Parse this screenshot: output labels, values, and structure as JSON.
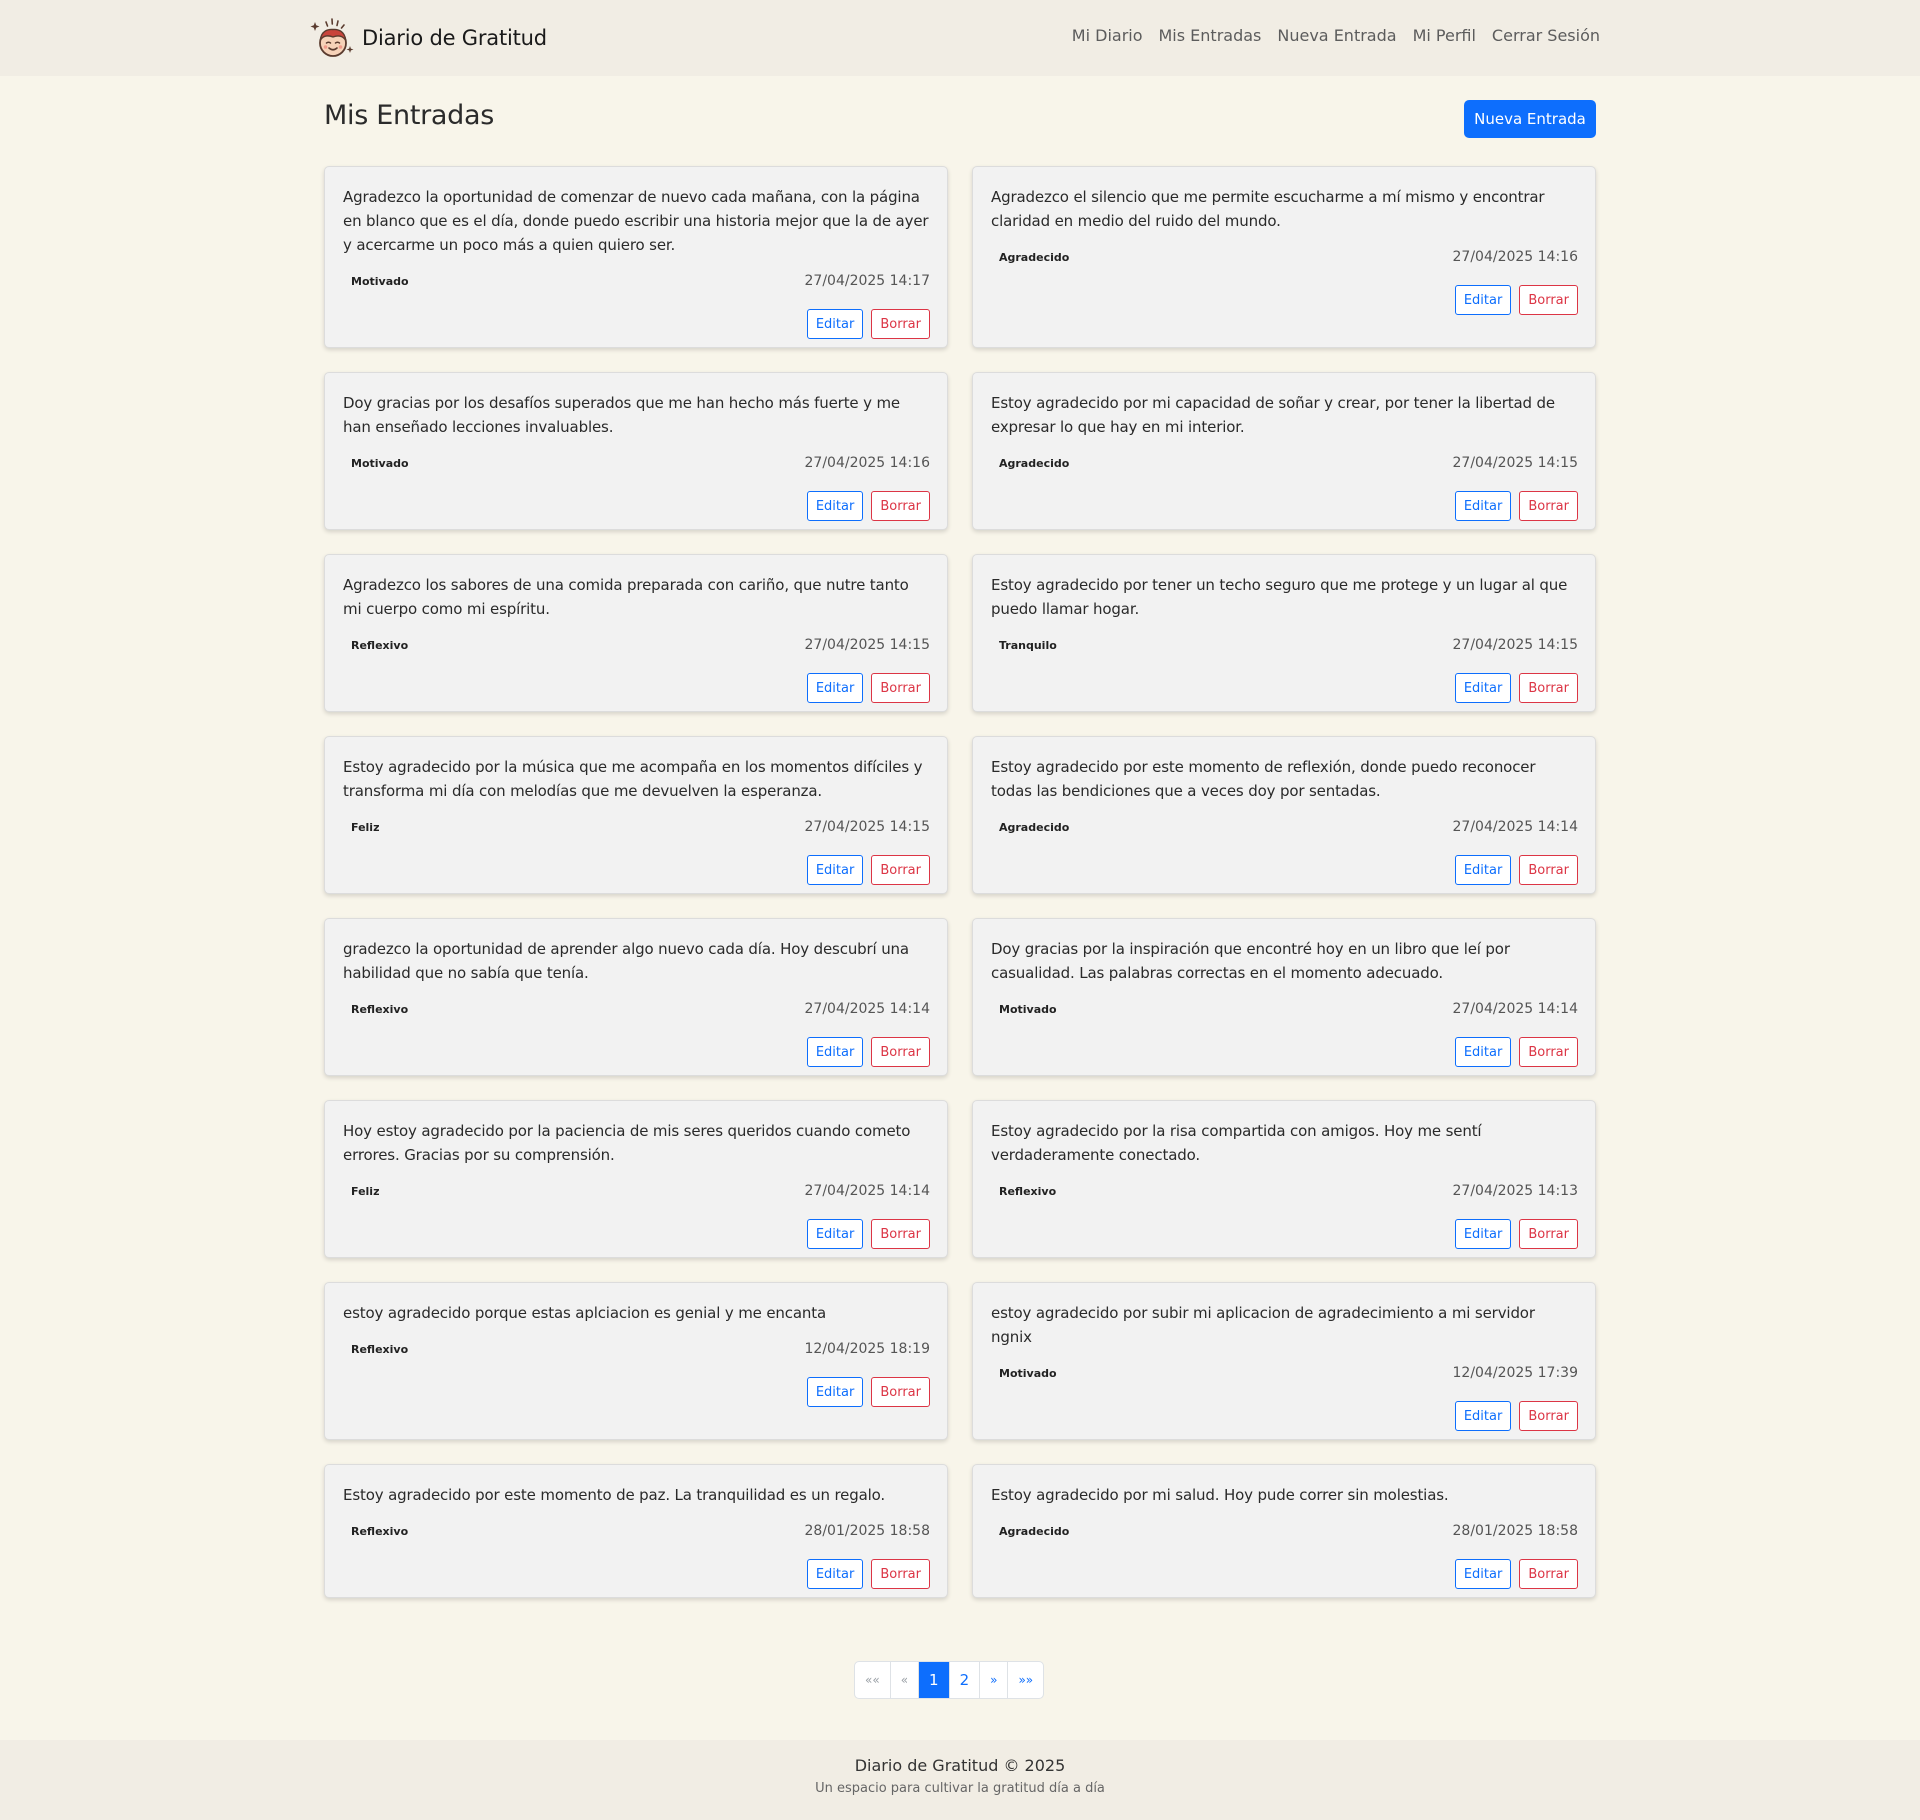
{
  "nav": {
    "brand": "Diario de Gratitud",
    "links": [
      "Mi Diario",
      "Mis Entradas",
      "Nueva Entrada",
      "Mi Perfil",
      "Cerrar Sesión"
    ]
  },
  "page": {
    "title": "Mis Entradas",
    "new_button": "Nueva Entrada"
  },
  "labels": {
    "edit": "Editar",
    "delete": "Borrar"
  },
  "entries": [
    {
      "text": "Agradezco la oportunidad de comenzar de nuevo cada mañana, con la página en blanco que es el día, donde puedo escribir una historia mejor que la de ayer y acercarme un poco más a quien quiero ser.",
      "mood": "Motivado",
      "date": "27/04/2025 14:17"
    },
    {
      "text": "Agradezco el silencio que me permite escucharme a mí mismo y encontrar claridad en medio del ruido del mundo.",
      "mood": "Agradecido",
      "date": "27/04/2025 14:16"
    },
    {
      "text": "Doy gracias por los desafíos superados que me han hecho más fuerte y me han enseñado lecciones invaluables.",
      "mood": "Motivado",
      "date": "27/04/2025 14:16"
    },
    {
      "text": "Estoy agradecido por mi capacidad de soñar y crear, por tener la libertad de expresar lo que hay en mi interior.",
      "mood": "Agradecido",
      "date": "27/04/2025 14:15"
    },
    {
      "text": "Agradezco los sabores de una comida preparada con cariño, que nutre tanto mi cuerpo como mi espíritu.",
      "mood": "Reflexivo",
      "date": "27/04/2025 14:15"
    },
    {
      "text": "Estoy agradecido por tener un techo seguro que me protege y un lugar al que puedo llamar hogar.",
      "mood": "Tranquilo",
      "date": "27/04/2025 14:15"
    },
    {
      "text": "Estoy agradecido por la música que me acompaña en los momentos difíciles y transforma mi día con melodías que me devuelven la esperanza.",
      "mood": "Feliz",
      "date": "27/04/2025 14:15"
    },
    {
      "text": "Estoy agradecido por este momento de reflexión, donde puedo reconocer todas las bendiciones que a veces doy por sentadas.",
      "mood": "Agradecido",
      "date": "27/04/2025 14:14"
    },
    {
      "text": "gradezco la oportunidad de aprender algo nuevo cada día. Hoy descubrí una habilidad que no sabía que tenía.",
      "mood": "Reflexivo",
      "date": "27/04/2025 14:14"
    },
    {
      "text": "Doy gracias por la inspiración que encontré hoy en un libro que leí por casualidad. Las palabras correctas en el momento adecuado.",
      "mood": "Motivado",
      "date": "27/04/2025 14:14"
    },
    {
      "text": "Hoy estoy agradecido por la paciencia de mis seres queridos cuando cometo errores. Gracias por su comprensión.",
      "mood": "Feliz",
      "date": "27/04/2025 14:14"
    },
    {
      "text": "Estoy agradecido por la risa compartida con amigos. Hoy me sentí verdaderamente conectado.",
      "mood": "Reflexivo",
      "date": "27/04/2025 14:13"
    },
    {
      "text": "estoy agradecido porque estas aplciacion es genial y me encanta",
      "mood": "Reflexivo",
      "date": "12/04/2025 18:19"
    },
    {
      "text": "estoy agradecido por subir mi aplicacion de agradecimiento a mi servidor ngnix",
      "mood": "Motivado",
      "date": "12/04/2025 17:39"
    },
    {
      "text": "Estoy agradecido por este momento de paz. La tranquilidad es un regalo.",
      "mood": "Reflexivo",
      "date": "28/01/2025 18:58"
    },
    {
      "text": "Estoy agradecido por mi salud. Hoy pude correr sin molestias.",
      "mood": "Agradecido",
      "date": "28/01/2025 18:58"
    }
  ],
  "pagination": {
    "first": "««",
    "prev": "«",
    "pages": [
      "1",
      "2"
    ],
    "active_page": "1",
    "next": "»",
    "last": "»»"
  },
  "footer": {
    "title": "Diario de Gratitud © 2025",
    "subtitle": "Un espacio para cultivar la gratitud día a día"
  },
  "colors": {
    "primary": "#0d6efd",
    "danger": "#dc3545",
    "background": "#f8f5ea",
    "navbar": "#f1ede4",
    "card": "#f2f2f2"
  }
}
